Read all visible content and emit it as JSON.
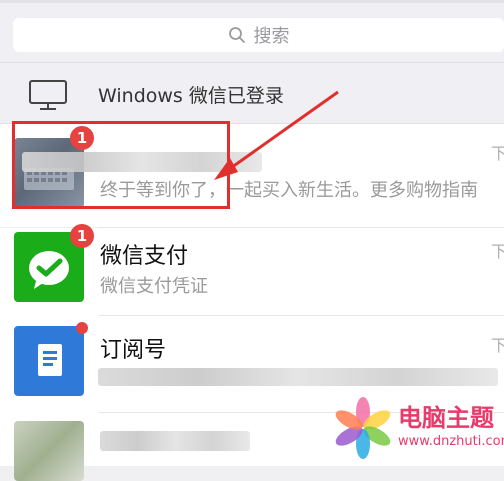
{
  "search": {
    "label": "搜索"
  },
  "login_bar": {
    "text": "Windows 微信已登录"
  },
  "chats": [
    {
      "name": "",
      "preview": "终于等到你了，一起买入新生活。更多购物指南",
      "time": "下",
      "badge": "1"
    },
    {
      "name": "微信支付",
      "preview": "微信支付凭证",
      "time": "下",
      "badge": "1"
    },
    {
      "name": "订阅号",
      "preview": "",
      "time": "下"
    },
    {
      "name": "",
      "preview": ""
    }
  ],
  "watermark": {
    "title": "电脑主题",
    "url": "www.dnzhuti.com"
  },
  "colors": {
    "badge": "#e64340",
    "wechat_pay_green": "#1aad19",
    "subscription_blue": "#2f7ad8",
    "annotation_red": "#e0302d"
  }
}
